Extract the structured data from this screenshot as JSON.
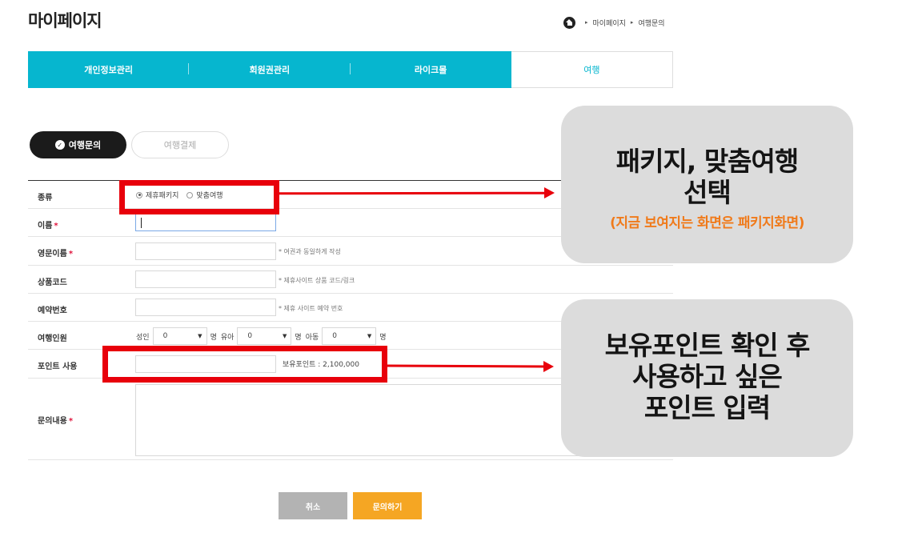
{
  "page_title": "마이페이지",
  "breadcrumb": {
    "items": [
      "마이페이지",
      "여행문의"
    ]
  },
  "tabs": [
    {
      "label": "개인정보관리"
    },
    {
      "label": "회원권관리"
    },
    {
      "label": "라이크몰"
    },
    {
      "label": "여행"
    }
  ],
  "subtabs": {
    "active": "여행문의",
    "inactive": "여행결제"
  },
  "form": {
    "type": {
      "label": "종류",
      "options": [
        "제휴패키지",
        "맞춤여행"
      ],
      "selected": "제휴패키지"
    },
    "name": {
      "label": "이름",
      "required_mark": "*",
      "value": ""
    },
    "eng_name": {
      "label": "영문이름",
      "required_mark": "*",
      "hint": "* 여권과 동일하게 작성",
      "value": ""
    },
    "product_code": {
      "label": "상품코드",
      "hint": "* 제휴사이트 상품 코드/링크",
      "value": ""
    },
    "reservation_no": {
      "label": "예약번호",
      "hint": "* 제휴 사이트 예약 번호",
      "value": ""
    },
    "travelers": {
      "label": "여행인원",
      "unit": "명",
      "groups": [
        {
          "label": "성인",
          "value": "0"
        },
        {
          "label": "유아",
          "value": "0"
        },
        {
          "label": "아동",
          "value": "0"
        }
      ]
    },
    "points": {
      "label": "포인트 사용",
      "value": "",
      "balance_text": "보유포인트 : 2,100,000"
    },
    "inquiry": {
      "label": "문의내용",
      "required_mark": "*",
      "value": ""
    }
  },
  "buttons": {
    "cancel": "취소",
    "submit": "문의하기"
  },
  "annotations": {
    "callout_a": {
      "line1": "패키지, 맞춤여행",
      "line2": "선택",
      "note": "(지금 보여지는 화면은 패키지화면)"
    },
    "callout_b": {
      "line1": "보유포인트 확인 후",
      "line2": "사용하고 싶은",
      "line3": "포인트 입력"
    }
  },
  "colors": {
    "accent": "#06b6cf",
    "submit": "#f5a623",
    "cancel": "#b3b3b3",
    "highlight": "#e8000b",
    "note": "#f07a1a"
  }
}
